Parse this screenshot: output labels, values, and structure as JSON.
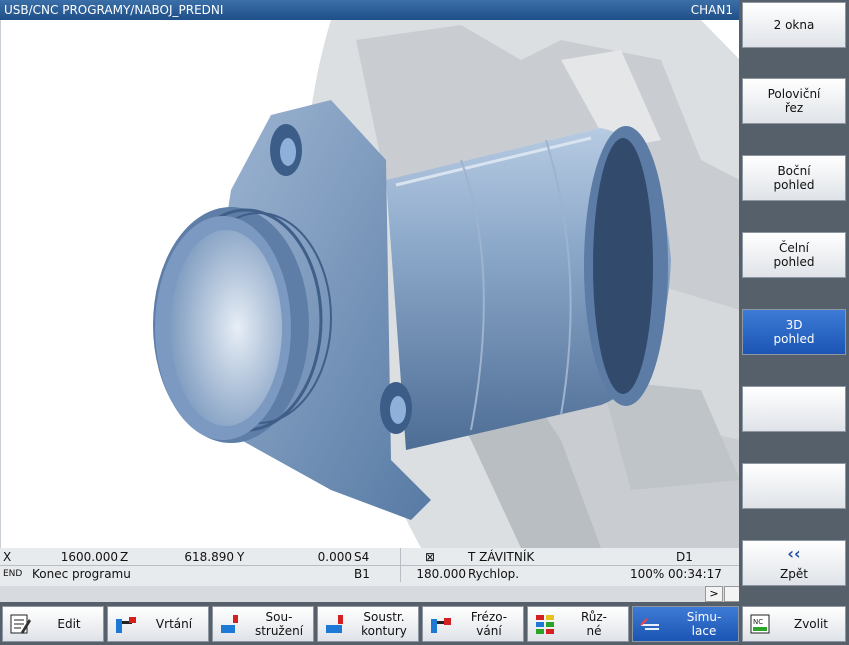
{
  "title_bar": {
    "path": "USB/CNC PROGRAMY/NABOJ_PREDNI",
    "channel": "CHAN1"
  },
  "status": {
    "row1": {
      "x_label": "X",
      "x_value": "1600.000",
      "z_label": "Z",
      "z_value": "618.890",
      "y_label": "Y",
      "y_value": "0.000",
      "s_label": "S4",
      "tool_icon": "⊠",
      "tool": "T ZÁVITNÍK",
      "d": "D1"
    },
    "row2": {
      "end_label": "END",
      "program_state": "Konec programu",
      "b": "B1",
      "feed_value": "180.000",
      "feed_label": "Rychlop.",
      "override": "100%",
      "time": "00:34:17"
    },
    "more_indicator": ">"
  },
  "vertical_softkeys": [
    {
      "label_line1": "2 okna",
      "label_line2": "",
      "active": false
    },
    {
      "label_line1": "Poloviční",
      "label_line2": "řez",
      "active": false
    },
    {
      "label_line1": "Boční",
      "label_line2": "pohled",
      "active": false
    },
    {
      "label_line1": "Čelní",
      "label_line2": "pohled",
      "active": false
    },
    {
      "label_line1": "3D",
      "label_line2": "pohled",
      "active": true
    },
    {
      "label_line1": "",
      "label_line2": "",
      "active": false
    },
    {
      "label_line1": "",
      "label_line2": "",
      "active": false
    },
    {
      "label_line1": "‹‹",
      "label_line2": "Zpět",
      "active": false
    }
  ],
  "horizontal_softkeys": [
    {
      "label_line1": "Edit",
      "label_line2": "",
      "icon": "edit-icon"
    },
    {
      "label_line1": "Vrtání",
      "label_line2": "",
      "icon": "drilling-icon"
    },
    {
      "label_line1": "Sou-",
      "label_line2": "stružení",
      "icon": "turning-icon"
    },
    {
      "label_line1": "Soustr.",
      "label_line2": "kontury",
      "icon": "contour-turning-icon"
    },
    {
      "label_line1": "Frézo-",
      "label_line2": "vání",
      "icon": "milling-icon"
    },
    {
      "label_line1": "Růz-",
      "label_line2": "né",
      "icon": "various-icon"
    },
    {
      "label_line1": "Simu-",
      "label_line2": "lace",
      "icon": "simulation-icon",
      "active": true
    },
    {
      "label_line1": "Zvolit",
      "label_line2": "",
      "icon": "nc-select-icon"
    }
  ],
  "colors": {
    "title_bar": "#2a5d98",
    "active_softkey": "#2a66c6",
    "part_blue": "#6f8fb5",
    "chuck_gray": "#cfd3d6"
  }
}
